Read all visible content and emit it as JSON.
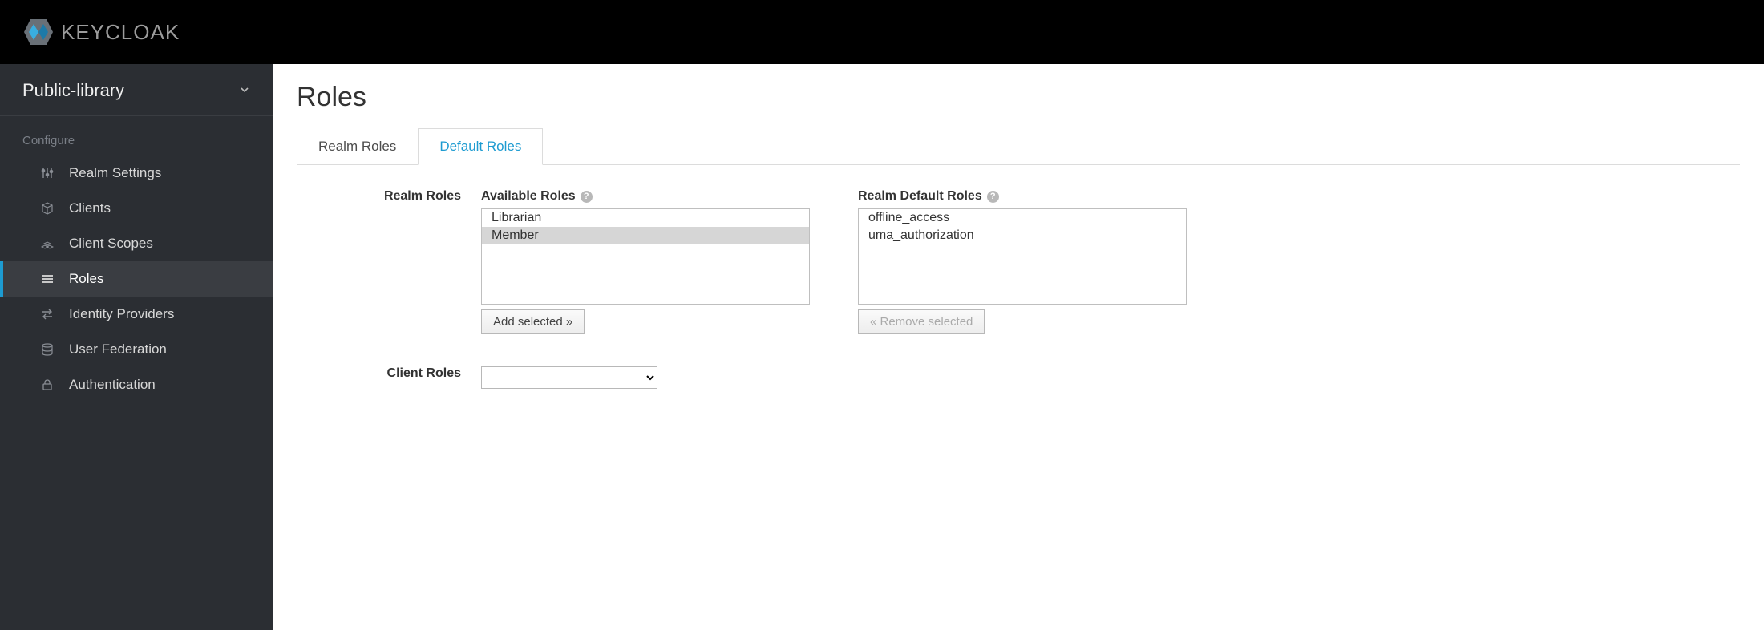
{
  "brand": "KEYCLOAK",
  "realm": "Public-library",
  "sidebar": {
    "section": "Configure",
    "items": [
      {
        "label": "Realm Settings"
      },
      {
        "label": "Clients"
      },
      {
        "label": "Client Scopes"
      },
      {
        "label": "Roles"
      },
      {
        "label": "Identity Providers"
      },
      {
        "label": "User Federation"
      },
      {
        "label": "Authentication"
      }
    ]
  },
  "page_title": "Roles",
  "tabs": [
    {
      "label": "Realm Roles"
    },
    {
      "label": "Default Roles"
    }
  ],
  "form": {
    "realm_roles_label": "Realm Roles",
    "available_roles_label": "Available Roles",
    "realm_default_roles_label": "Realm Default Roles",
    "add_selected_label": "Add selected »",
    "remove_selected_label": "« Remove selected",
    "client_roles_label": "Client Roles",
    "available_roles": [
      {
        "name": "Librarian",
        "selected": false
      },
      {
        "name": "Member",
        "selected": true
      }
    ],
    "default_roles": [
      {
        "name": "offline_access",
        "selected": false
      },
      {
        "name": "uma_authorization",
        "selected": false
      }
    ]
  }
}
